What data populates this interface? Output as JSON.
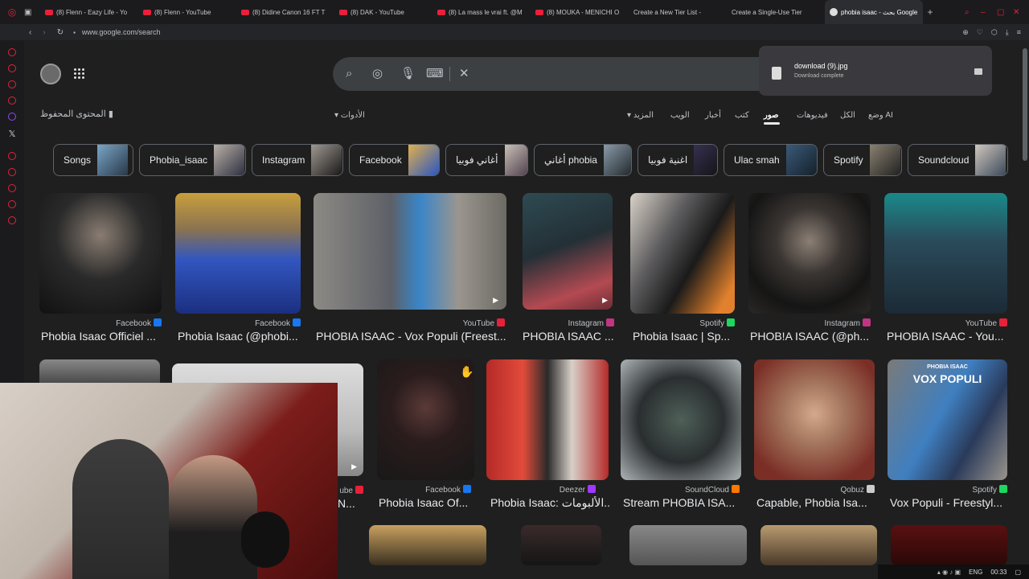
{
  "tabs": [
    {
      "label": "(8) Flenn - Eazy Life - Yo"
    },
    {
      "label": "(8) Flenn - YouTube"
    },
    {
      "label": "(8) Didine Canon 16 FT T"
    },
    {
      "label": "(8) DAK - YouTube"
    },
    {
      "label": "(8) La mass le vrai ft. @M"
    },
    {
      "label": "(8) MOUKA - MENICHI O"
    },
    {
      "label": "Create a New Tier List -"
    },
    {
      "label": "Create a Single-Use Tier"
    },
    {
      "label": "phobia isaac - بحث Google"
    }
  ],
  "url": "www.google.com/search",
  "saved_content": "المحتوى المحفوظ",
  "tools_label": "الأدوات",
  "nav": {
    "ai_mode": "وضع AI",
    "all": "الكل",
    "videos": "فيديوهات",
    "images": "صور",
    "books": "كتب",
    "news": "أخبار",
    "web": "الويب",
    "more": "المزيد"
  },
  "chips": [
    "Songs",
    "Phobia_isaac",
    "Instagram",
    "Facebook",
    "أغاني فوبيا",
    "أغاني phobia",
    "اغنية فوبيا",
    "Ulac smah",
    "Spotify",
    "Soundcloud"
  ],
  "row1": [
    {
      "source": "Facebook",
      "title": "Phobia Isaac Officiel ..."
    },
    {
      "source": "Facebook",
      "title": "Phobia Isaac (@phobi..."
    },
    {
      "source": "YouTube",
      "title": "PHOBIA ISAAC - Vox Populi (Freest..."
    },
    {
      "source": "Instagram",
      "title": "PHOBIA ISAAC ..."
    },
    {
      "source": "Spotify",
      "title": "Phobia Isaac | Sp..."
    },
    {
      "source": "Instagram",
      "title": "PHOB!A ISAAC (@ph..."
    },
    {
      "source": "YouTube",
      "title": "PHOBIA ISAAC - You..."
    }
  ],
  "row2": [
    {
      "source": "ube",
      "title": "N..."
    },
    {
      "source": "Facebook",
      "title": "Phobia Isaac Of..."
    },
    {
      "source": "Deezer",
      "title": "Phobia Isaac: الألبومات..."
    },
    {
      "source": "SoundCloud",
      "title": "Stream PHOBIA ISA..."
    },
    {
      "source": "Qobuz",
      "title": "Capable, Phobia Isa..."
    },
    {
      "source": "Spotify",
      "title": "Vox Populi - Freestyl..."
    }
  ],
  "poster_text": "PHOBIA ISAAC",
  "poster_title": "VOX POPULI",
  "download": {
    "filename": "download (9).jpg",
    "status": "Download complete"
  },
  "taskbar": {
    "lang": "ENG",
    "time": "00:33"
  },
  "colors": {
    "youtube": "#e8203a",
    "facebook": "#1877f2",
    "instagram": "#c13584",
    "spotify": "#1ed760",
    "soundcloud": "#ff7700",
    "deezer": "#a238ff",
    "qobuz": "#cccccc"
  }
}
